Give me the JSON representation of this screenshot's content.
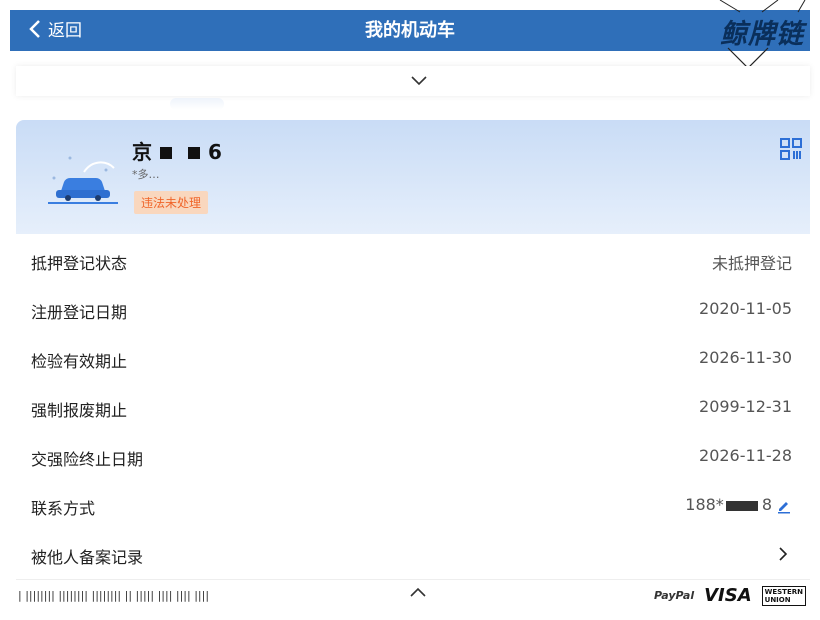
{
  "header": {
    "back_label": "返回",
    "title": "我的机动车",
    "logo_text": "鲸牌链"
  },
  "vehicle": {
    "plate_prefix": "京",
    "plate_suffix": "6",
    "sub_text": "*多…",
    "violation_badge": "违法未处理"
  },
  "rows": [
    {
      "label": "抵押登记状态",
      "value": "未抵押登记"
    },
    {
      "label": "注册登记日期",
      "value": "2020-11-05"
    },
    {
      "label": "检验有效期止",
      "value": "2026-11-30"
    },
    {
      "label": "强制报废期止",
      "value": "2099-12-31"
    },
    {
      "label": "交强险终止日期",
      "value": "2026-11-28"
    },
    {
      "label": "联系方式",
      "value_prefix": "188*",
      "value_suffix": "8"
    },
    {
      "label": "被他人备案记录"
    }
  ],
  "footer": {
    "barcode_text": "| |||||||| |||||||| |||||||| || ||||| |||| |||| ||||",
    "paypal": "PayPal",
    "visa": "VISA",
    "wu_line1": "WESTERN",
    "wu_line2": "UNION"
  },
  "colors": {
    "header_bg": "#2f6fb9",
    "badge_text": "#f0652a",
    "badge_bg": "#f9d7be",
    "card_bg": "#c9dcf6",
    "edit_icon": "#2d6fd6"
  },
  "icons": [
    "chevron-left-icon",
    "chevron-down-icon",
    "car-icon",
    "qr-code-icon",
    "edit-icon",
    "chevron-right-icon",
    "chevron-up-icon"
  ]
}
